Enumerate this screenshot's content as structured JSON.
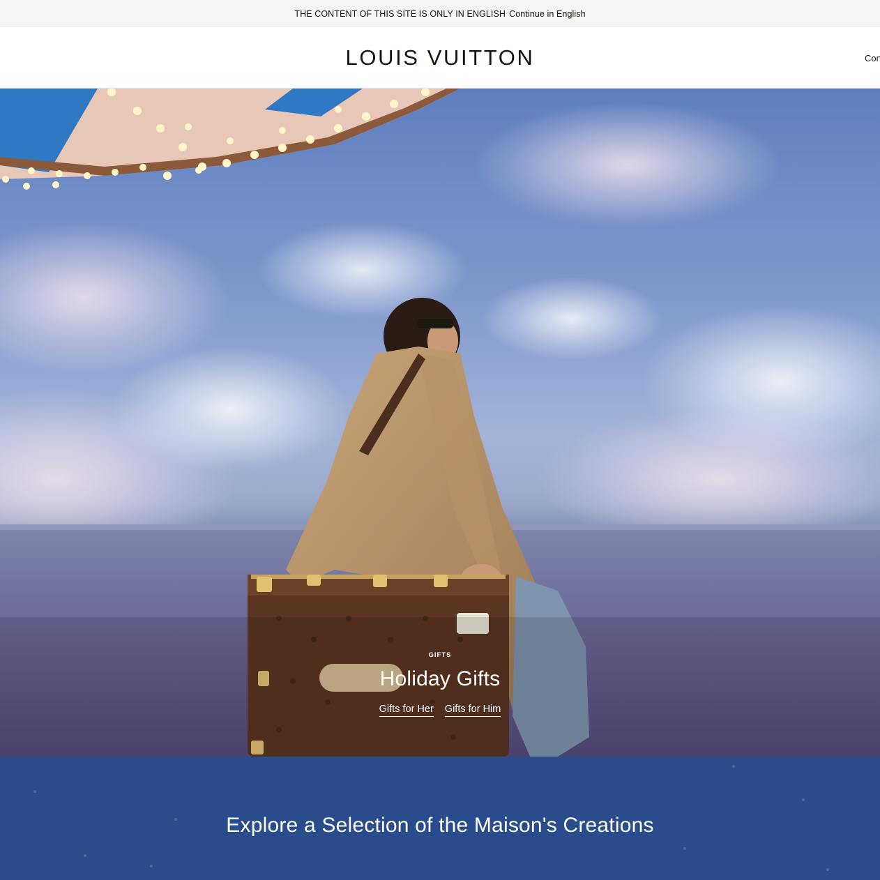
{
  "lang_bar": {
    "message": "THE CONTENT OF THIS SITE IS ONLY IN ENGLISH",
    "continue": "Continue in English"
  },
  "header": {
    "logo": "LOUIS VUITTON",
    "right_text": "Contact Us"
  },
  "hero": {
    "eyebrow": "GIFTS",
    "title": "Holiday Gifts",
    "links": [
      "Gifts for Her",
      "Gifts for Him"
    ]
  },
  "explore": {
    "title": "Explore a Selection of the Maison's Creations"
  },
  "colors": {
    "lang_bar_bg": "#f6f5f3",
    "text": "#19110b",
    "explore_bg": "#294c8c"
  }
}
